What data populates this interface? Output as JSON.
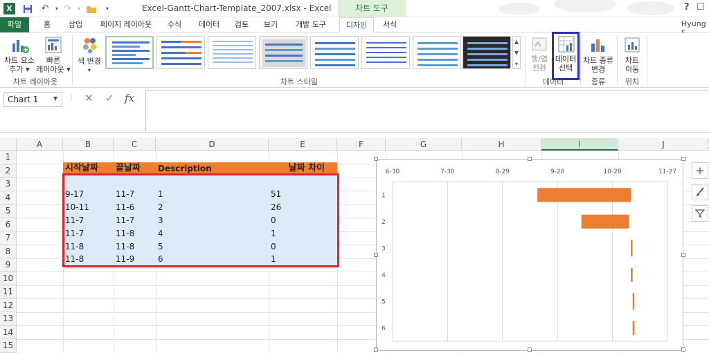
{
  "titlebar": {
    "logo": "X",
    "doc_title": "Excel-Gantt-Chart-Template_2007.xlsx - Excel",
    "context_tab": "차트 도구",
    "help": "?",
    "ribbon_options": "☐"
  },
  "tabs": {
    "file": "파일",
    "items": [
      "홈",
      "삽입",
      "페이지 레이아웃",
      "수식",
      "데이터",
      "검토",
      "보기",
      "개발 도구",
      "디자인",
      "서식"
    ],
    "user": "Hyung S"
  },
  "ribbon": {
    "add_chart_element": [
      "차트 요소",
      "추가 ▾"
    ],
    "quick_layout": [
      "빠른",
      "레이아웃 ▾"
    ],
    "change_colors": "색 변경",
    "group_layouts": "차트 레이아웃",
    "group_styles": "차트 스타일",
    "switch_row_col": [
      "행/열",
      "전환"
    ],
    "select_data": [
      "데이터",
      "선택"
    ],
    "group_data": "데이터",
    "change_chart_type": [
      "차트 종류",
      "변경"
    ],
    "group_type": "종류",
    "move_chart": [
      "차트",
      "이동"
    ],
    "group_location": "위치"
  },
  "formula_bar": {
    "name_box": "Chart 1",
    "cancel": "✕",
    "enter": "✓",
    "fx": "fx",
    "formula": ""
  },
  "grid": {
    "columns": [
      "A",
      "B",
      "C",
      "D",
      "E",
      "F",
      "G",
      "H",
      "I",
      "J"
    ],
    "rows": [
      "1",
      "2",
      "3",
      "4",
      "5",
      "6",
      "7",
      "8",
      "9",
      "10",
      "11",
      "12",
      "13",
      "14",
      "15"
    ],
    "headers": {
      "start": "시작날짜",
      "end": "끝날짜",
      "desc": "Description",
      "diff": "날짜 차이"
    },
    "data": [
      [
        "9-17",
        "11-7",
        "1",
        "51"
      ],
      [
        "10-11",
        "11-6",
        "2",
        "26"
      ],
      [
        "11-7",
        "11-7",
        "3",
        "0"
      ],
      [
        "11-7",
        "11-8",
        "4",
        "1"
      ],
      [
        "11-8",
        "11-8",
        "5",
        "0"
      ],
      [
        "11-8",
        "11-9",
        "6",
        "1"
      ]
    ]
  },
  "chart_data": {
    "type": "bar",
    "orientation": "horizontal",
    "x_ticks": [
      "6-30",
      "7-30",
      "8-29",
      "9-28",
      "10-28",
      "11-27"
    ],
    "categories": [
      "1",
      "2",
      "3",
      "4",
      "5",
      "6"
    ],
    "series": [
      {
        "start": [
          "9-17",
          "10-11",
          "11-7",
          "11-7",
          "11-8",
          "11-8"
        ]
      },
      {
        "duration_days": [
          51,
          26,
          0,
          1,
          0,
          1
        ]
      }
    ],
    "bar_color": "#ED7D31",
    "grid": true
  },
  "side_buttons": [
    "+",
    "🖌",
    "⊽"
  ]
}
